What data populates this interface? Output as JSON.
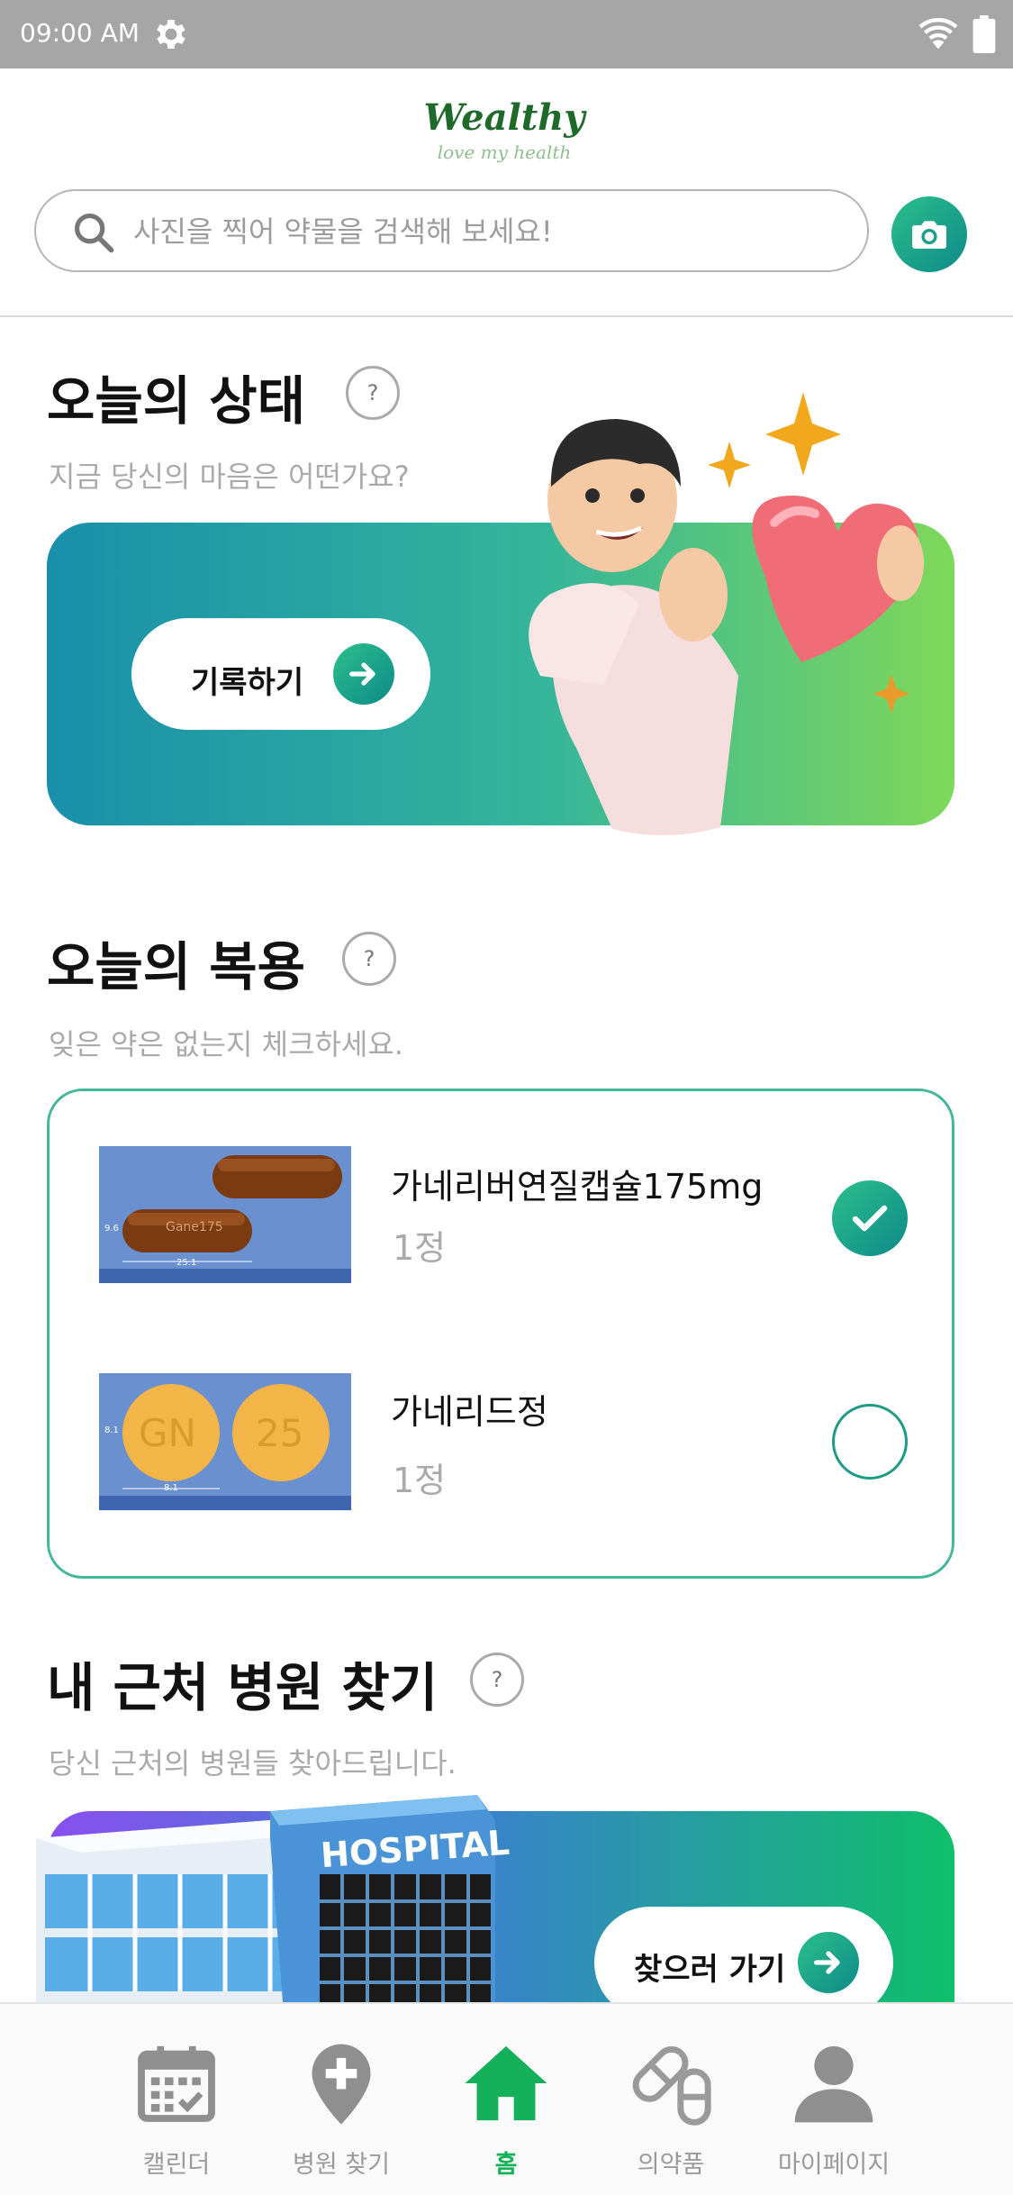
{
  "status_bar": {
    "time": "09:00 AM"
  },
  "header": {
    "logo_text": "Wealthy",
    "logo_tagline": "love my health",
    "search_placeholder": "사진을 찍어 약물을 검색해 보세요!"
  },
  "today_status": {
    "title": "오늘의 상태",
    "help": "?",
    "subtitle": "지금 당신의 마음은 어떤가요?",
    "button_label": "기록하기"
  },
  "today_medication": {
    "title": "오늘의 복용",
    "help": "?",
    "subtitle": "잊은 약은 없는지 체크하세요.",
    "items": [
      {
        "name": "가네리버연질캡슐175mg",
        "quantity": "1정",
        "checked": true,
        "imprint": "Gane175",
        "dim_w": "25.1",
        "dim_h": "9.6"
      },
      {
        "name": "가네리드정",
        "quantity": "1정",
        "checked": false,
        "imprint_left": "GN",
        "imprint_right": "25",
        "dim_w": "8.1",
        "dim_h": "8.1"
      }
    ]
  },
  "nearby_hospital": {
    "title": "내 근처 병원 찾기",
    "help": "?",
    "subtitle": "당신 근처의 병원들 찾아드립니다.",
    "button_label": "찾으러 가기",
    "sign_text": "HOSPITAL"
  },
  "bottom_nav": {
    "items": [
      {
        "label": "캘린더",
        "icon": "calendar-icon"
      },
      {
        "label": "병원 찾기",
        "icon": "hospital-pin-icon"
      },
      {
        "label": "홈",
        "icon": "home-icon",
        "active": true
      },
      {
        "label": "의약품",
        "icon": "pill-icon"
      },
      {
        "label": "마이페이지",
        "icon": "person-icon"
      }
    ]
  },
  "colors": {
    "accent_green": "#14b05a",
    "teal": "#0f8a8a",
    "status_bar": "#a6a6a6"
  }
}
